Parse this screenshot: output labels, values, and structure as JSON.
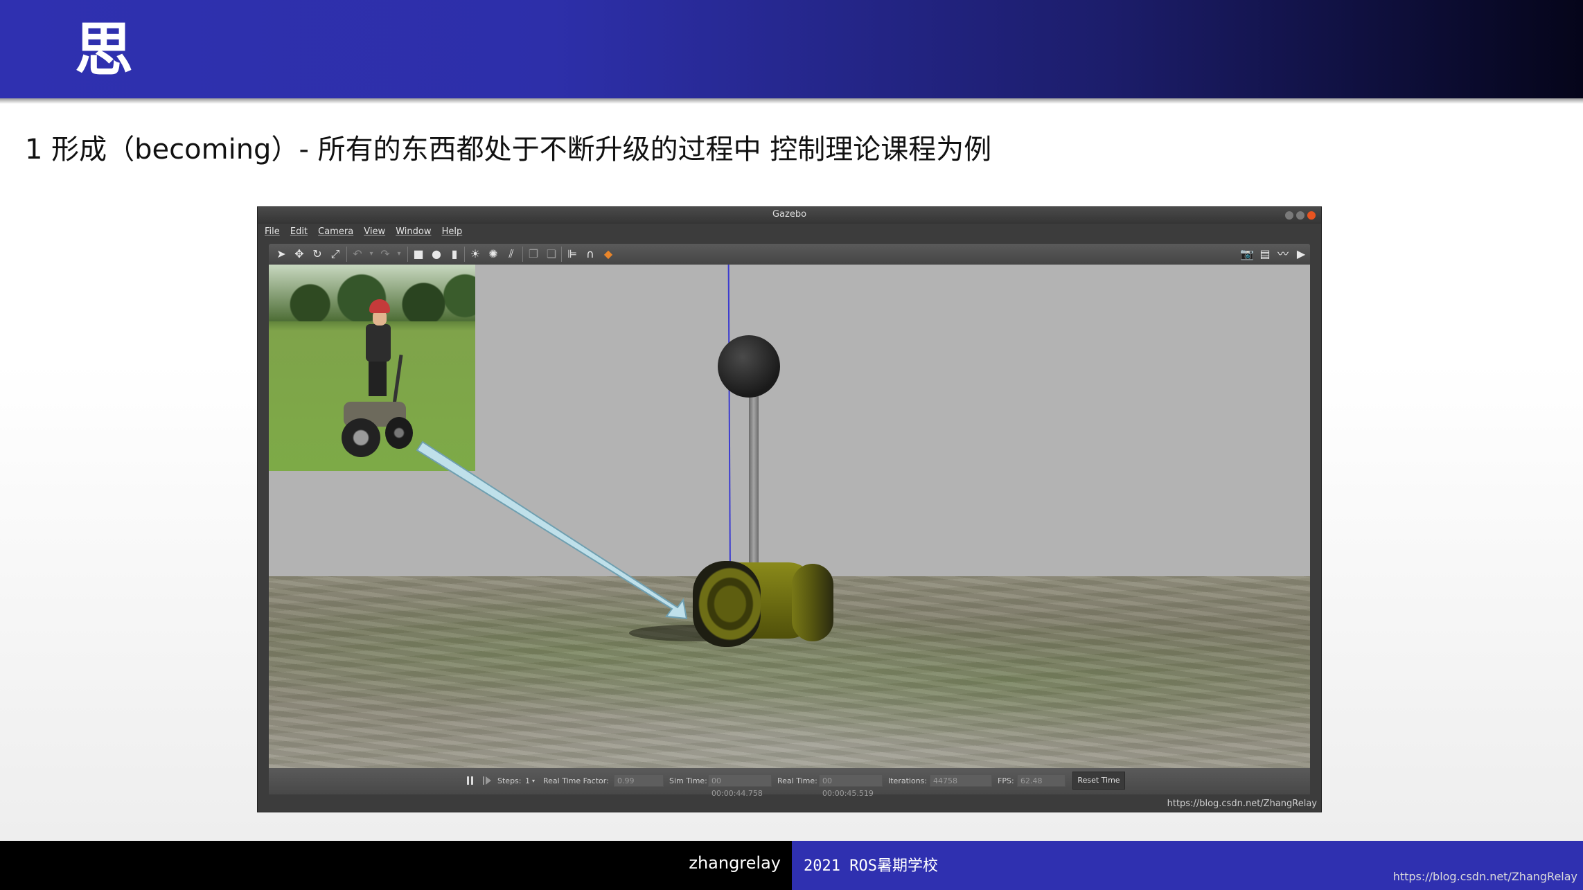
{
  "slide": {
    "header_char": "思",
    "subtitle": "1 形成（becoming）- 所有的东西都处于不断升级的过程中 控制理论课程为例"
  },
  "gazebo": {
    "window_title": "Gazebo",
    "menu": [
      "File",
      "Edit",
      "Camera",
      "View",
      "Window",
      "Help"
    ],
    "toolbar_left_icons": [
      "select-arrow-icon",
      "translate-icon",
      "rotate-icon",
      "scale-icon",
      "undo-icon",
      "undo-dropdown-icon",
      "redo-icon",
      "redo-dropdown-icon",
      "box-shape-icon",
      "sphere-shape-icon",
      "cylinder-shape-icon",
      "point-light-icon",
      "spot-light-icon",
      "directional-light-icon",
      "copy-icon",
      "paste-icon",
      "align-icon",
      "snap-icon",
      "select-color-icon"
    ],
    "toolbar_right_icons": [
      "screenshot-icon",
      "log-icon",
      "plot-icon",
      "video-record-icon"
    ],
    "status": {
      "steps_label": "Steps:",
      "steps_value": "1",
      "rtf_label": "Real Time Factor:",
      "rtf_value": "0.99",
      "sim_time_label": "Sim Time:",
      "sim_time_value": "00 00:00:44.758",
      "real_time_label": "Real Time:",
      "real_time_value": "00 00:00:45.519",
      "iterations_label": "Iterations:",
      "iterations_value": "44758",
      "fps_label": "FPS:",
      "fps_value": "62.48",
      "reset_label": "Reset Time"
    },
    "watermark": "https://blog.csdn.net/ZhangRelay"
  },
  "footer": {
    "author": "zhangrelay",
    "school": "2021 ROS暑期学校",
    "url": "https://blog.csdn.net/ZhangRelay"
  },
  "colors": {
    "header_blue": "#2f30b0",
    "footer_blue": "#2f30b0",
    "close_orange": "#e95420"
  }
}
